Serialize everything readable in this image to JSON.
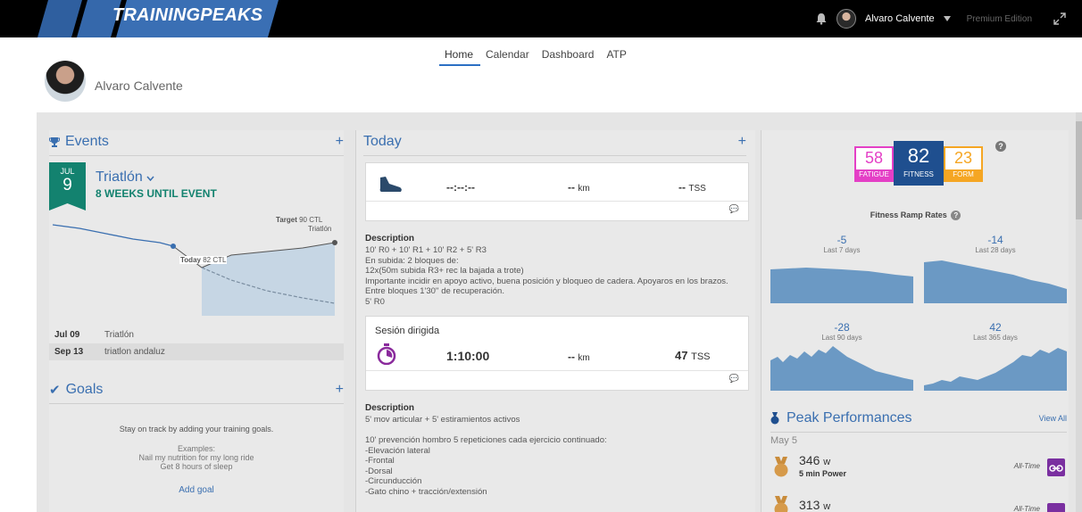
{
  "topbar": {
    "logo": "TRAININGPEAKS",
    "user_name": "Alvaro Calvente",
    "edition": "Premium Edition"
  },
  "profile": {
    "name": "Alvaro Calvente"
  },
  "nav": {
    "items": [
      "Home",
      "Calendar",
      "Dashboard",
      "ATP"
    ],
    "active": "Home"
  },
  "events": {
    "title": "Events",
    "plus": "+",
    "month": "JUL",
    "day": "9",
    "event_name": "Triatlón",
    "countdown": "8 WEEKS UNTIL EVENT",
    "target_prefix": "Target",
    "target_value": "90 CTL",
    "target_event": "Triatlón",
    "today_label": "Today",
    "today_value": "82 CTL",
    "list": [
      {
        "date": "Jul 09",
        "name": "Triatlón"
      },
      {
        "date": "Sep 13",
        "name": "triatlon andaluz"
      }
    ]
  },
  "goals": {
    "title": "Goals",
    "plus": "+",
    "message": "Stay on track by adding your training goals.",
    "examples_title": "Examples:",
    "example_1": "Nail my nutrition for my long ride",
    "example_2": "Get 8 hours of sleep",
    "add_goal": "Add goal"
  },
  "today": {
    "title": "Today",
    "plus": "+",
    "workout1": {
      "time": "--:--:--",
      "distance": "--",
      "distance_unit": "km",
      "tss": "--",
      "tss_unit": "TSS"
    },
    "desc1_title": "Description",
    "desc1_lines": [
      "10' R0 + 10' R1 + 10' R2 + 5' R3",
      "En subida: 2 bloques de:",
      "12x(50m subida R3+ rec la bajada a trote)",
      "Importante incidir en apoyo activo, buena posición y bloqueo de cadera. Apoyaros en los brazos.",
      "Entre bloques 1'30'' de recuperación.",
      "5' R0"
    ],
    "workout2": {
      "title": "Sesión dirigida",
      "time": "1:10:00",
      "distance": "--",
      "distance_unit": "km",
      "tss": "47",
      "tss_unit": "TSS"
    },
    "desc2_title": "Description",
    "desc2_lines": [
      "5' mov articular + 5' estiramientos activos",
      "",
      "10' prevención hombro 5 repeticiones cada ejercicio continuado:",
      "-Elevación lateral",
      "-Frontal",
      "-Dorsal",
      "-Circunducción",
      "-Gato chino + tracción/extensión"
    ]
  },
  "fitness": {
    "fatigue": {
      "value": "58",
      "label": "FATIGUE",
      "color": "#e43fc6"
    },
    "fitness": {
      "value": "82",
      "label": "FITNESS",
      "color": "#1f4f8f"
    },
    "form": {
      "value": "23",
      "label": "FORM",
      "color": "#f5a623"
    },
    "help": "?",
    "ramp_title": "Fitness Ramp Rates",
    "ramps": [
      {
        "value": "-5",
        "label": "Last 7 days"
      },
      {
        "value": "-14",
        "label": "Last 28 days"
      },
      {
        "value": "-28",
        "label": "Last 90 days"
      },
      {
        "value": "42",
        "label": "Last 365 days"
      }
    ]
  },
  "peak": {
    "title": "Peak Performances",
    "view_all": "View All",
    "date": "May 5",
    "items": [
      {
        "value": "346",
        "unit": "w",
        "desc": "5 min Power",
        "range": "All-Time"
      },
      {
        "value": "313",
        "unit": "w",
        "desc": "",
        "range": "All-Time"
      }
    ]
  }
}
